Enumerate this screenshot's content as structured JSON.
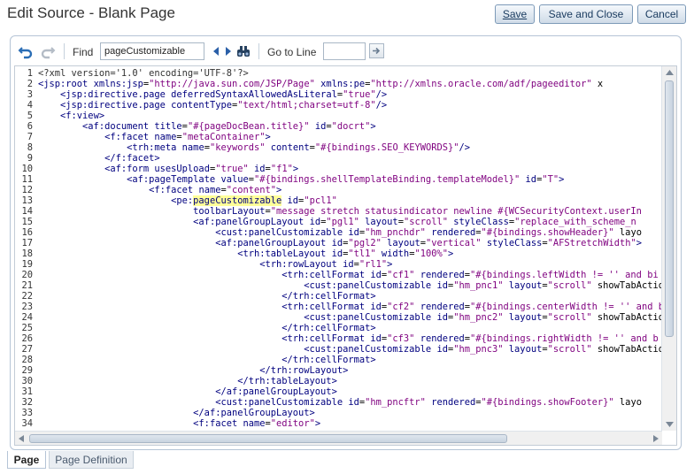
{
  "window": {
    "title": "Edit Source - Blank Page"
  },
  "header_buttons": {
    "save": "Save",
    "save_and_close": "Save and Close",
    "cancel": "Cancel"
  },
  "toolbar": {
    "undo_icon": "undo-icon",
    "redo_icon": "redo-icon",
    "find_label": "Find",
    "find_value": "pageCustomizable",
    "goto_label": "Go to Line",
    "goto_value": ""
  },
  "editor": {
    "lines": [
      {
        "n": "1",
        "t": "<?xml version='1.0' encoding='UTF-8'?>"
      },
      {
        "n": "2",
        "t": "<jsp:root xmlns:jsp=\"http://java.sun.com/JSP/Page\" xmlns:pe=\"http://xmlns.oracle.com/adf/pageeditor\" x"
      },
      {
        "n": "3",
        "t": "    <jsp:directive.page deferredSyntaxAllowedAsLiteral=\"true\"/>"
      },
      {
        "n": "4",
        "t": "    <jsp:directive.page contentType=\"text/html;charset=utf-8\"/>"
      },
      {
        "n": "5",
        "t": "    <f:view>"
      },
      {
        "n": "6",
        "t": "        <af:document title=\"#{pageDocBean.title}\" id=\"docrt\">"
      },
      {
        "n": "7",
        "t": "            <f:facet name=\"metaContainer\">"
      },
      {
        "n": "8",
        "t": "                <trh:meta name=\"keywords\" content=\"#{bindings.SEO_KEYWORDS}\"/>"
      },
      {
        "n": "9",
        "t": "            </f:facet>"
      },
      {
        "n": "10",
        "t": "            <af:form usesUpload=\"true\" id=\"f1\">"
      },
      {
        "n": "11",
        "t": "                <af:pageTemplate value=\"#{bindings.shellTemplateBinding.templateModel}\" id=\"T\">"
      },
      {
        "n": "12",
        "t": "                    <f:facet name=\"content\">"
      },
      {
        "n": "13",
        "t": "                        <pe:pageCustomizable id=\"pcl1\""
      },
      {
        "n": "14",
        "t": "                            toolbarLayout=\"message stretch statusindicator newline #{WCSecurityContext.userIn"
      },
      {
        "n": "15",
        "t": "                            <af:panelGroupLayout id=\"pgl1\" layout=\"scroll\" styleClass=\"replace_with_scheme_n"
      },
      {
        "n": "16",
        "t": "                                <cust:panelCustomizable id=\"hm_pnchdr\" rendered=\"#{bindings.showHeader}\" layo"
      },
      {
        "n": "17",
        "t": "                                <af:panelGroupLayout id=\"pgl2\" layout=\"vertical\" styleClass=\"AFStretchWidth\">"
      },
      {
        "n": "18",
        "t": "                                    <trh:tableLayout id=\"tl1\" width=\"100%\">"
      },
      {
        "n": "19",
        "t": "                                        <trh:rowLayout id=\"rl1\">"
      },
      {
        "n": "20",
        "t": "                                            <trh:cellFormat id=\"cf1\" rendered=\"#{bindings.leftWidth != '' and bi"
      },
      {
        "n": "21",
        "t": "                                                <cust:panelCustomizable id=\"hm_pnc1\" layout=\"scroll\" showTabActio"
      },
      {
        "n": "22",
        "t": "                                            </trh:cellFormat>"
      },
      {
        "n": "23",
        "t": "                                            <trh:cellFormat id=\"cf2\" rendered=\"#{bindings.centerWidth != '' and b"
      },
      {
        "n": "24",
        "t": "                                                <cust:panelCustomizable id=\"hm_pnc2\" layout=\"scroll\" showTabActio"
      },
      {
        "n": "25",
        "t": "                                            </trh:cellFormat>"
      },
      {
        "n": "26",
        "t": "                                            <trh:cellFormat id=\"cf3\" rendered=\"#{bindings.rightWidth != '' and b"
      },
      {
        "n": "27",
        "t": "                                                <cust:panelCustomizable id=\"hm_pnc3\" layout=\"scroll\" showTabActio"
      },
      {
        "n": "28",
        "t": "                                            </trh:cellFormat>"
      },
      {
        "n": "29",
        "t": "                                        </trh:rowLayout>"
      },
      {
        "n": "30",
        "t": "                                    </trh:tableLayout>"
      },
      {
        "n": "31",
        "t": "                                </af:panelGroupLayout>"
      },
      {
        "n": "32",
        "t": "                                <cust:panelCustomizable id=\"hm_pncftr\" rendered=\"#{bindings.showFooter}\" layo"
      },
      {
        "n": "33",
        "t": "                            </af:panelGroupLayout>"
      },
      {
        "n": "34",
        "t": "                            <f:facet name=\"editor\">"
      }
    ]
  },
  "tabs": {
    "page": "Page",
    "page_definition": "Page Definition"
  },
  "colors": {
    "tag": "#00007f",
    "string": "#7f007f",
    "highlight": "#ffff99"
  }
}
